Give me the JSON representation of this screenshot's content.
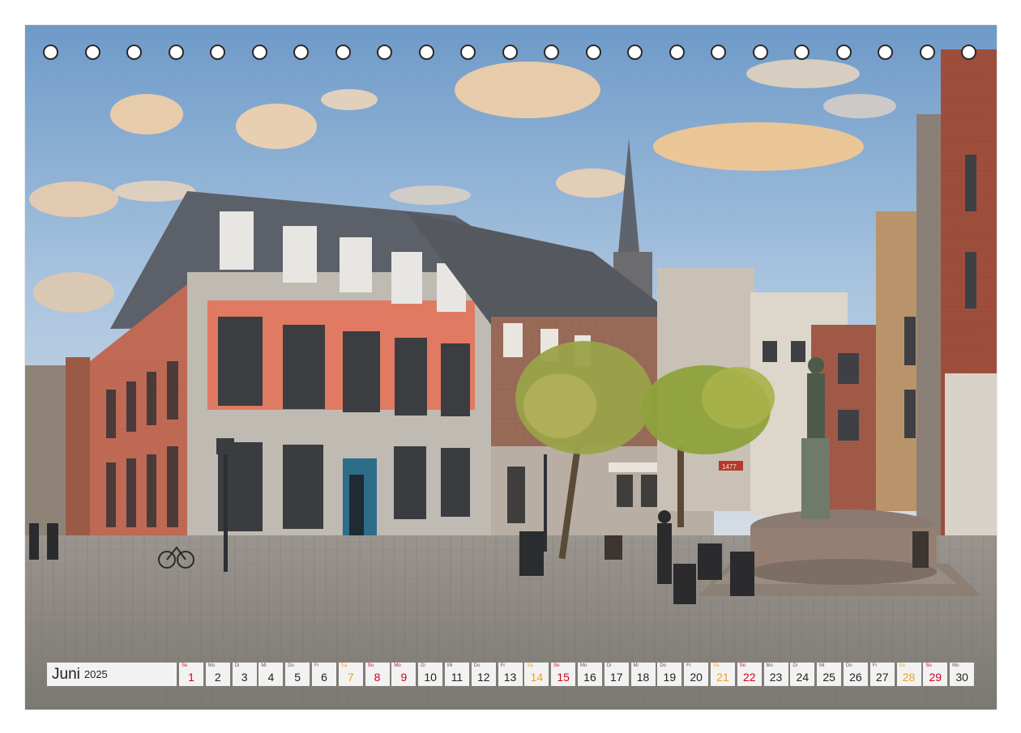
{
  "calendar": {
    "month": "Juni",
    "year": "2025",
    "days": [
      {
        "n": "1",
        "wd": "So",
        "kind": "sun"
      },
      {
        "n": "2",
        "wd": "Mo",
        "kind": ""
      },
      {
        "n": "3",
        "wd": "Di",
        "kind": ""
      },
      {
        "n": "4",
        "wd": "Mi",
        "kind": ""
      },
      {
        "n": "5",
        "wd": "Do",
        "kind": ""
      },
      {
        "n": "6",
        "wd": "Fr",
        "kind": ""
      },
      {
        "n": "7",
        "wd": "Sa",
        "kind": "sat"
      },
      {
        "n": "8",
        "wd": "So",
        "kind": "sun"
      },
      {
        "n": "9",
        "wd": "Mo",
        "kind": "hol"
      },
      {
        "n": "10",
        "wd": "Di",
        "kind": ""
      },
      {
        "n": "11",
        "wd": "Mi",
        "kind": ""
      },
      {
        "n": "12",
        "wd": "Do",
        "kind": ""
      },
      {
        "n": "13",
        "wd": "Fr",
        "kind": ""
      },
      {
        "n": "14",
        "wd": "Sa",
        "kind": "sat"
      },
      {
        "n": "15",
        "wd": "So",
        "kind": "sun"
      },
      {
        "n": "16",
        "wd": "Mo",
        "kind": ""
      },
      {
        "n": "17",
        "wd": "Di",
        "kind": ""
      },
      {
        "n": "18",
        "wd": "Mi",
        "kind": ""
      },
      {
        "n": "19",
        "wd": "Do",
        "kind": ""
      },
      {
        "n": "20",
        "wd": "Fr",
        "kind": ""
      },
      {
        "n": "21",
        "wd": "Sa",
        "kind": "sat"
      },
      {
        "n": "22",
        "wd": "So",
        "kind": "sun"
      },
      {
        "n": "23",
        "wd": "Mo",
        "kind": ""
      },
      {
        "n": "24",
        "wd": "Di",
        "kind": ""
      },
      {
        "n": "25",
        "wd": "Mi",
        "kind": ""
      },
      {
        "n": "26",
        "wd": "Do",
        "kind": ""
      },
      {
        "n": "27",
        "wd": "Fr",
        "kind": ""
      },
      {
        "n": "28",
        "wd": "Sa",
        "kind": "sat"
      },
      {
        "n": "29",
        "wd": "So",
        "kind": "sun"
      },
      {
        "n": "30",
        "wd": "Mo",
        "kind": ""
      }
    ]
  },
  "binding": {
    "hole_count": 23
  },
  "photo": {
    "sign_text": "1477"
  },
  "colors": {
    "sunday": "#d0021b",
    "saturday": "#f0a020"
  }
}
